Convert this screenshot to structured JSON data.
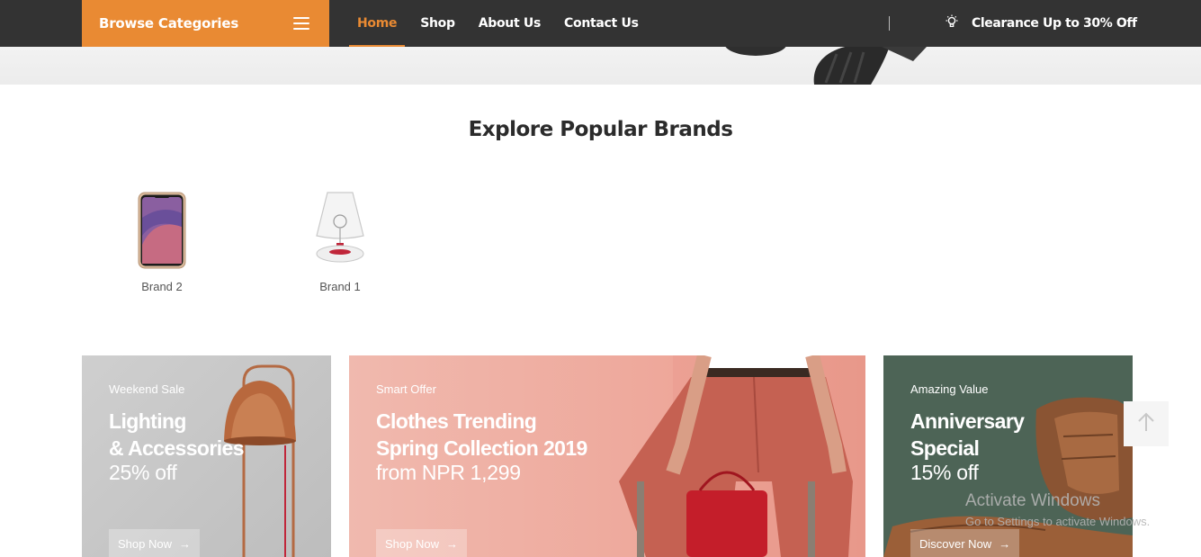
{
  "nav": {
    "browse_label": "Browse Categories",
    "menu": [
      "Home",
      "Shop",
      "About Us",
      "Contact Us"
    ],
    "active_index": 0,
    "promo": "Clearance Up to 30% Off"
  },
  "brands": {
    "title": "Explore Popular Brands",
    "items": [
      {
        "name": "Brand 2",
        "icon": "smartphone-icon"
      },
      {
        "name": "Brand 1",
        "icon": "lamp-icon"
      }
    ]
  },
  "banners": [
    {
      "kicker": "Weekend Sale",
      "title_line1": "Lighting",
      "title_line2": "& Accessories",
      "price": "25% off",
      "button": "Shop Now"
    },
    {
      "kicker": "Smart Offer",
      "title_line1": "Clothes Trending",
      "title_line2": "Spring Collection 2019",
      "price": "from NPR 1,299",
      "button": "Shop Now"
    },
    {
      "kicker": "Amazing Value",
      "title_line1": "Anniversary",
      "title_line2": "Special",
      "price": "15% off",
      "button": "Discover Now"
    }
  ],
  "back_to_top_icon": "arrow-up-icon",
  "watermark": {
    "line1": "Activate Windows",
    "line2": "Go to Settings to activate Windows."
  },
  "colors": {
    "accent": "#e98a33",
    "nav_bg": "#333333",
    "banner_green": "#4d6456",
    "banner_pink": "#eea89b"
  }
}
